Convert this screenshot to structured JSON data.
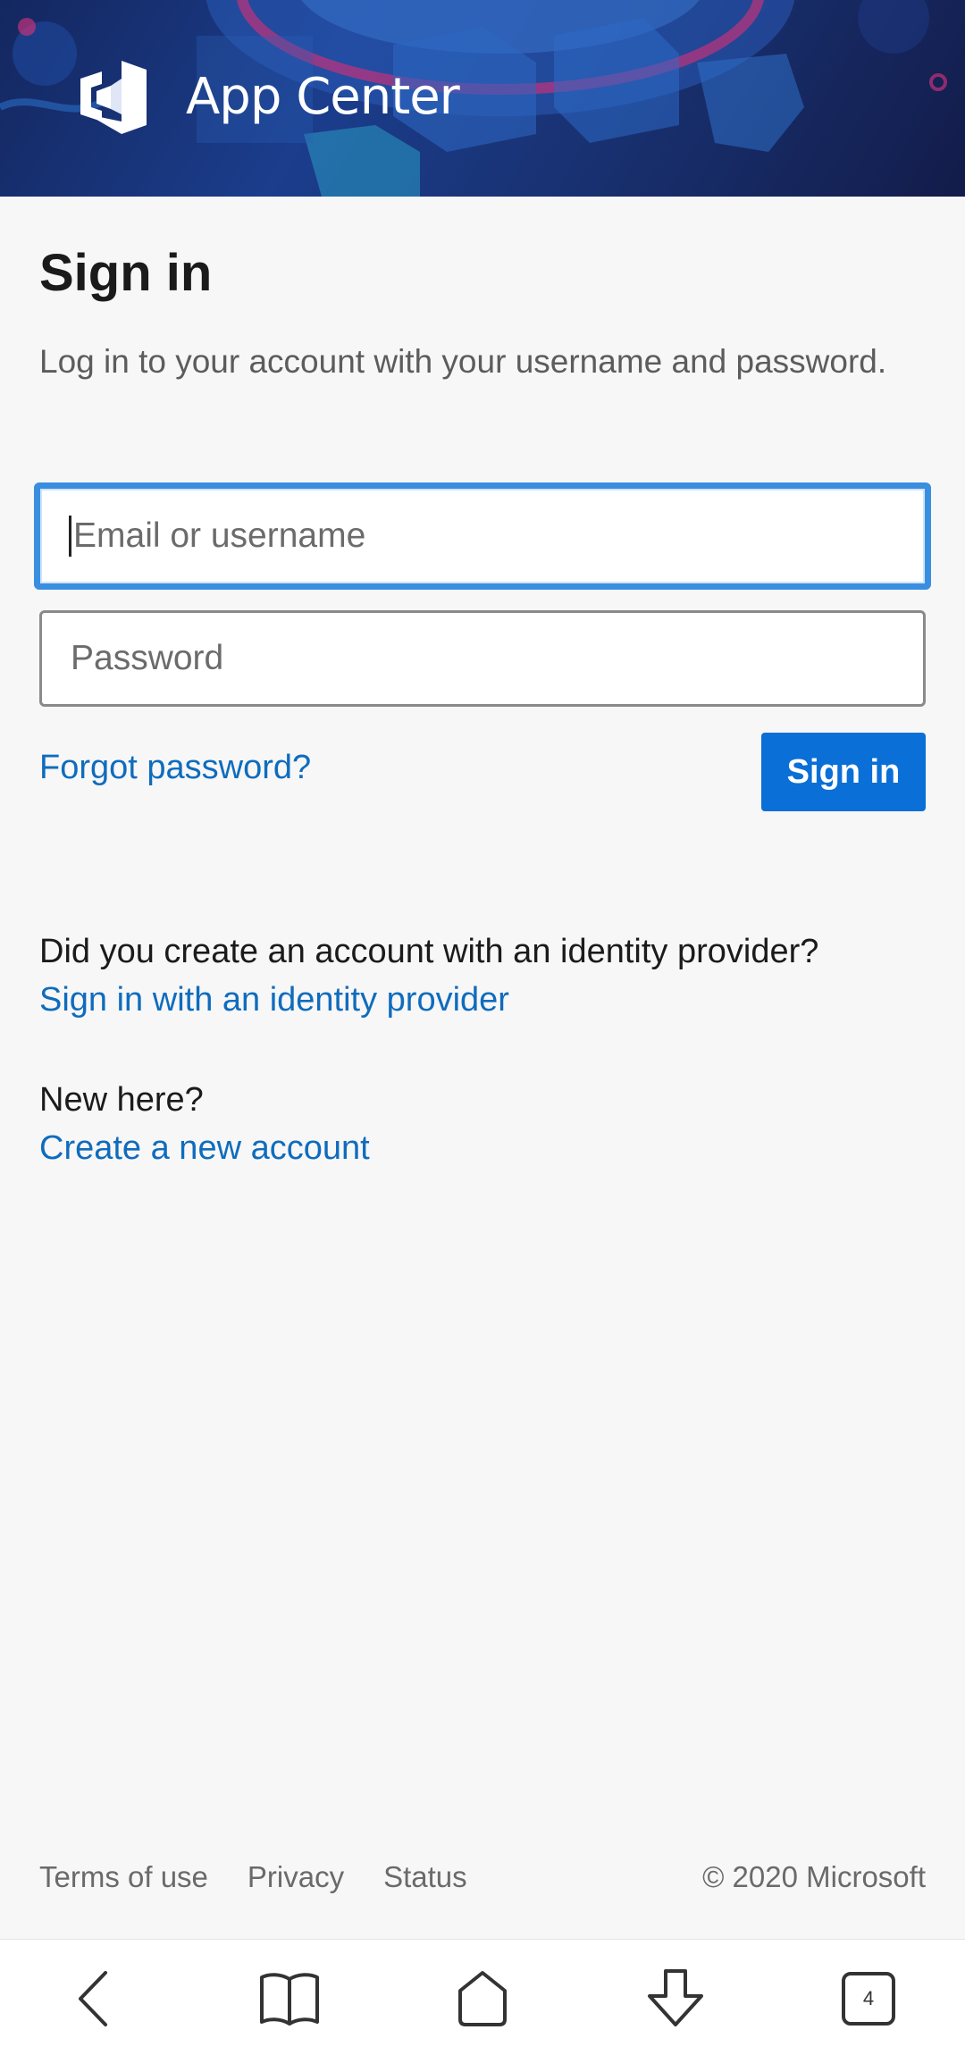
{
  "header": {
    "app_name": "App Center"
  },
  "signin": {
    "title": "Sign in",
    "subtitle": "Log in to your account with your username and password.",
    "email_placeholder": "Email or username",
    "password_placeholder": "Password",
    "forgot_label": "Forgot password?",
    "button_label": "Sign in"
  },
  "identity": {
    "question": "Did you create an account with an identity provider?",
    "link": "Sign in with an identity provider"
  },
  "new_account": {
    "question": "New here?",
    "link": "Create a new account"
  },
  "footer": {
    "links": [
      "Terms of use",
      "Privacy",
      "Status"
    ],
    "copyright": "© 2020 Microsoft"
  },
  "navbar": {
    "tab_count": "4",
    "icons": [
      "back-icon",
      "bookmarks-icon",
      "home-icon",
      "download-icon",
      "tabs-icon"
    ]
  },
  "colors": {
    "accent": "#0a6fd6",
    "link": "#0f6cbd",
    "banner": "#1b3d8c",
    "focus_border": "#3a8ee0"
  }
}
